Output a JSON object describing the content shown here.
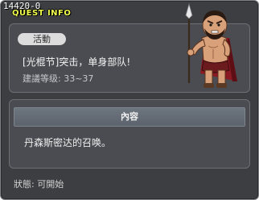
{
  "window": {
    "quest_id": "14420-0",
    "title": "QUEST INFO"
  },
  "quest": {
    "badge": "活動",
    "name": "[光棍节]突击，单身部队!",
    "level": "建議等级: 33~37"
  },
  "npc": {
    "icon": "spartan-warrior-npc"
  },
  "content": {
    "header": "內容",
    "text": "丹森斯密达的召唤。"
  },
  "status": "狀態: 可開始",
  "colors": {
    "window_bg": "#3d3e42",
    "panel_bg": "#4a4c51",
    "title": "#f2ff4d"
  }
}
